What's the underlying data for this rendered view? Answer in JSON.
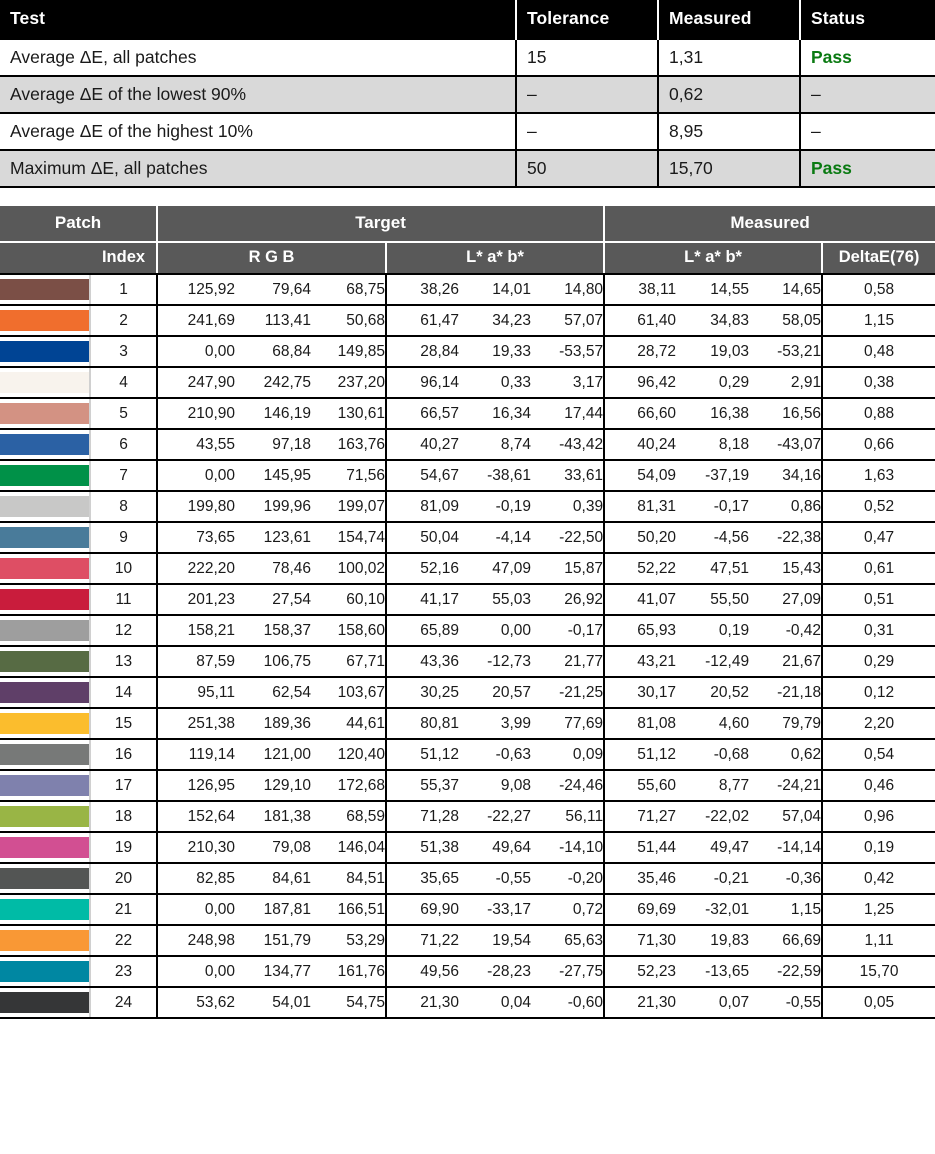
{
  "summary": {
    "columns": [
      "Test",
      "Tolerance",
      "Measured",
      "Status"
    ],
    "rows": [
      {
        "test": "Average ΔE, all patches",
        "tolerance": "15",
        "measured": "1,31",
        "status": "Pass",
        "pass": true
      },
      {
        "test": "Average ΔE of the lowest 90%",
        "tolerance": "–",
        "measured": "0,62",
        "status": "–",
        "pass": false
      },
      {
        "test": "Average ΔE of the highest 10%",
        "tolerance": "–",
        "measured": "8,95",
        "status": "–",
        "pass": false
      },
      {
        "test": "Maximum ΔE, all patches",
        "tolerance": "50",
        "measured": "15,70",
        "status": "Pass",
        "pass": true
      }
    ]
  },
  "patch_table": {
    "group_headers": {
      "patch": "Patch",
      "target": "Target",
      "measured": "Measured"
    },
    "sub_headers": {
      "index": "Index",
      "target_rgb": "R G B",
      "target_lab": "L* a* b*",
      "measured_lab": "L* a* b*",
      "deltae": "DeltaE(76)"
    },
    "rows": [
      {
        "index": "1",
        "swatch": "#7b4f46",
        "t_r": "125,92",
        "t_g": "79,64",
        "t_b": "68,75",
        "t_L": "38,26",
        "t_a": "14,01",
        "t_bs": "14,80",
        "m_L": "38,11",
        "m_a": "14,55",
        "m_bs": "14,65",
        "de": "0,58"
      },
      {
        "index": "2",
        "swatch": "#f06e2d",
        "t_r": "241,69",
        "t_g": "113,41",
        "t_b": "50,68",
        "t_L": "61,47",
        "t_a": "34,23",
        "t_bs": "57,07",
        "m_L": "61,40",
        "m_a": "34,83",
        "m_bs": "58,05",
        "de": "1,15"
      },
      {
        "index": "3",
        "swatch": "#004494",
        "t_r": "0,00",
        "t_g": "68,84",
        "t_b": "149,85",
        "t_L": "28,84",
        "t_a": "19,33",
        "t_bs": "-53,57",
        "m_L": "28,72",
        "m_a": "19,03",
        "m_bs": "-53,21",
        "de": "0,48"
      },
      {
        "index": "4",
        "swatch": "#f8f3ed",
        "t_r": "247,90",
        "t_g": "242,75",
        "t_b": "237,20",
        "t_L": "96,14",
        "t_a": "0,33",
        "t_bs": "3,17",
        "m_L": "96,42",
        "m_a": "0,29",
        "m_bs": "2,91",
        "de": "0,38"
      },
      {
        "index": "5",
        "swatch": "#d39283",
        "t_r": "210,90",
        "t_g": "146,19",
        "t_b": "130,61",
        "t_L": "66,57",
        "t_a": "16,34",
        "t_bs": "17,44",
        "m_L": "66,60",
        "m_a": "16,38",
        "m_bs": "16,56",
        "de": "0,88"
      },
      {
        "index": "6",
        "swatch": "#2b61a4",
        "t_r": "43,55",
        "t_g": "97,18",
        "t_b": "163,76",
        "t_L": "40,27",
        "t_a": "8,74",
        "t_bs": "-43,42",
        "m_L": "40,24",
        "m_a": "8,18",
        "m_bs": "-43,07",
        "de": "0,66"
      },
      {
        "index": "7",
        "swatch": "#009148",
        "t_r": "0,00",
        "t_g": "145,95",
        "t_b": "71,56",
        "t_L": "54,67",
        "t_a": "-38,61",
        "t_bs": "33,61",
        "m_L": "54,09",
        "m_a": "-37,19",
        "m_bs": "34,16",
        "de": "1,63"
      },
      {
        "index": "8",
        "swatch": "#c8c8c7",
        "t_r": "199,80",
        "t_g": "199,96",
        "t_b": "199,07",
        "t_L": "81,09",
        "t_a": "-0,19",
        "t_bs": "0,39",
        "m_L": "81,31",
        "m_a": "-0,17",
        "m_bs": "0,86",
        "de": "0,52"
      },
      {
        "index": "9",
        "swatch": "#497b9a",
        "t_r": "73,65",
        "t_g": "123,61",
        "t_b": "154,74",
        "t_L": "50,04",
        "t_a": "-4,14",
        "t_bs": "-22,50",
        "m_L": "50,20",
        "m_a": "-4,56",
        "m_bs": "-22,38",
        "de": "0,47"
      },
      {
        "index": "10",
        "swatch": "#de4e64",
        "t_r": "222,20",
        "t_g": "78,46",
        "t_b": "100,02",
        "t_L": "52,16",
        "t_a": "47,09",
        "t_bs": "15,87",
        "m_L": "52,22",
        "m_a": "47,51",
        "m_bs": "15,43",
        "de": "0,61"
      },
      {
        "index": "11",
        "swatch": "#c91c3c",
        "t_r": "201,23",
        "t_g": "27,54",
        "t_b": "60,10",
        "t_L": "41,17",
        "t_a": "55,03",
        "t_bs": "26,92",
        "m_L": "41,07",
        "m_a": "55,50",
        "m_bs": "27,09",
        "de": "0,51"
      },
      {
        "index": "12",
        "swatch": "#9e9e9e",
        "t_r": "158,21",
        "t_g": "158,37",
        "t_b": "158,60",
        "t_L": "65,89",
        "t_a": "0,00",
        "t_bs": "-0,17",
        "m_L": "65,93",
        "m_a": "0,19",
        "m_bs": "-0,42",
        "de": "0,31"
      },
      {
        "index": "13",
        "swatch": "#576b44",
        "t_r": "87,59",
        "t_g": "106,75",
        "t_b": "67,71",
        "t_L": "43,36",
        "t_a": "-12,73",
        "t_bs": "21,77",
        "m_L": "43,21",
        "m_a": "-12,49",
        "m_bs": "21,67",
        "de": "0,29"
      },
      {
        "index": "14",
        "swatch": "#5f3f68",
        "t_r": "95,11",
        "t_g": "62,54",
        "t_b": "103,67",
        "t_L": "30,25",
        "t_a": "20,57",
        "t_bs": "-21,25",
        "m_L": "30,17",
        "m_a": "20,52",
        "m_bs": "-21,18",
        "de": "0,12"
      },
      {
        "index": "15",
        "swatch": "#fbbd2d",
        "t_r": "251,38",
        "t_g": "189,36",
        "t_b": "44,61",
        "t_L": "80,81",
        "t_a": "3,99",
        "t_bs": "77,69",
        "m_L": "81,08",
        "m_a": "4,60",
        "m_bs": "79,79",
        "de": "2,20"
      },
      {
        "index": "16",
        "swatch": "#777978",
        "t_r": "119,14",
        "t_g": "121,00",
        "t_b": "120,40",
        "t_L": "51,12",
        "t_a": "-0,63",
        "t_bs": "0,09",
        "m_L": "51,12",
        "m_a": "-0,68",
        "m_bs": "0,62",
        "de": "0,54"
      },
      {
        "index": "17",
        "swatch": "#7f81ad",
        "t_r": "126,95",
        "t_g": "129,10",
        "t_b": "172,68",
        "t_L": "55,37",
        "t_a": "9,08",
        "t_bs": "-24,46",
        "m_L": "55,60",
        "m_a": "8,77",
        "m_bs": "-24,21",
        "de": "0,46"
      },
      {
        "index": "18",
        "swatch": "#99b545",
        "t_r": "152,64",
        "t_g": "181,38",
        "t_b": "68,59",
        "t_L": "71,28",
        "t_a": "-22,27",
        "t_bs": "56,11",
        "m_L": "71,27",
        "m_a": "-22,02",
        "m_bs": "57,04",
        "de": "0,96"
      },
      {
        "index": "19",
        "swatch": "#d24f92",
        "t_r": "210,30",
        "t_g": "79,08",
        "t_b": "146,04",
        "t_L": "51,38",
        "t_a": "49,64",
        "t_bs": "-14,10",
        "m_L": "51,44",
        "m_a": "49,47",
        "m_bs": "-14,14",
        "de": "0,19"
      },
      {
        "index": "20",
        "swatch": "#535554",
        "t_r": "82,85",
        "t_g": "84,61",
        "t_b": "84,51",
        "t_L": "35,65",
        "t_a": "-0,55",
        "t_bs": "-0,20",
        "m_L": "35,46",
        "m_a": "-0,21",
        "m_bs": "-0,36",
        "de": "0,42"
      },
      {
        "index": "21",
        "swatch": "#00bba6",
        "t_r": "0,00",
        "t_g": "187,81",
        "t_b": "166,51",
        "t_L": "69,90",
        "t_a": "-33,17",
        "t_bs": "0,72",
        "m_L": "69,69",
        "m_a": "-32,01",
        "m_bs": "1,15",
        "de": "1,25"
      },
      {
        "index": "22",
        "swatch": "#f99835",
        "t_r": "248,98",
        "t_g": "151,79",
        "t_b": "53,29",
        "t_L": "71,22",
        "t_a": "19,54",
        "t_bs": "65,63",
        "m_L": "71,30",
        "m_a": "19,83",
        "m_bs": "66,69",
        "de": "1,11"
      },
      {
        "index": "23",
        "swatch": "#0087a2",
        "t_r": "0,00",
        "t_g": "134,77",
        "t_b": "161,76",
        "t_L": "49,56",
        "t_a": "-28,23",
        "t_bs": "-27,75",
        "m_L": "52,23",
        "m_a": "-13,65",
        "m_bs": "-22,59",
        "de": "15,70"
      },
      {
        "index": "24",
        "swatch": "#353637",
        "t_r": "53,62",
        "t_g": "54,01",
        "t_b": "54,75",
        "t_L": "21,30",
        "t_a": "0,04",
        "t_bs": "-0,60",
        "m_L": "21,30",
        "m_a": "0,07",
        "m_bs": "-0,55",
        "de": "0,05"
      }
    ]
  },
  "colors": {
    "summary_header_bg": "#000000",
    "patch_header_bg": "#595959",
    "alt_row_bg": "#d9d9d9",
    "pass_green": "#0a7a12"
  }
}
